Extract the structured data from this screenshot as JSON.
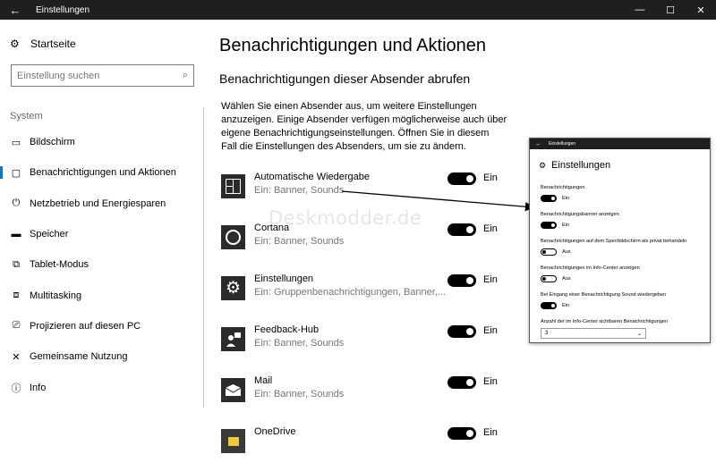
{
  "window": {
    "title": "Einstellungen",
    "back_glyph": "←",
    "min_glyph": "—",
    "max_glyph": "☐",
    "close_glyph": "✕"
  },
  "sidebar": {
    "home_label": "Startseite",
    "search_placeholder": "Einstellung suchen",
    "section_label": "System",
    "items": [
      {
        "label": "Bildschirm",
        "icon": "monitor-icon",
        "glyph": "▭"
      },
      {
        "label": "Benachrichtigungen und Aktionen",
        "icon": "notification-icon",
        "glyph": "▢"
      },
      {
        "label": "Netzbetrieb und Energiesparen",
        "icon": "power-icon",
        "glyph": "⏻"
      },
      {
        "label": "Speicher",
        "icon": "storage-icon",
        "glyph": "▬"
      },
      {
        "label": "Tablet-Modus",
        "icon": "tablet-icon",
        "glyph": "⧉"
      },
      {
        "label": "Multitasking",
        "icon": "multitasking-icon",
        "glyph": "⧈"
      },
      {
        "label": "Projizieren auf diesen PC",
        "icon": "project-icon",
        "glyph": "⎚"
      },
      {
        "label": "Gemeinsame Nutzung",
        "icon": "shared-icon",
        "glyph": "✕"
      },
      {
        "label": "Info",
        "icon": "info-icon",
        "glyph": "ⓘ"
      }
    ]
  },
  "main": {
    "title": "Benachrichtigungen und Aktionen",
    "subtitle": "Benachrichtigungen dieser Absender abrufen",
    "description": "Wählen Sie einen Absender aus, um weitere Einstellungen anzuzeigen. Einige Absender verfügen möglicherweise auch über eigene Benachrichtigungseinstellungen. Öffnen Sie in diesem Fall die Einstellungen des Absenders, um sie zu ändern.",
    "toggle_on_label": "Ein",
    "senders": [
      {
        "name": "Automatische Wiedergabe",
        "sub": "Ein: Banner, Sounds",
        "icon": "autoplay-icon"
      },
      {
        "name": "Cortana",
        "sub": "Ein: Banner, Sounds",
        "icon": "cortana-icon"
      },
      {
        "name": "Einstellungen",
        "sub": "Ein: Gruppenbenachrichtigungen, Banner,...",
        "icon": "settings-gear-icon"
      },
      {
        "name": "Feedback-Hub",
        "sub": "Ein: Banner, Sounds",
        "icon": "feedback-hub-icon"
      },
      {
        "name": "Mail",
        "sub": "Ein: Banner, Sounds",
        "icon": "mail-icon"
      },
      {
        "name": "OneDrive",
        "sub": "",
        "icon": "onedrive-icon"
      }
    ]
  },
  "watermark": "Deskmodder.de",
  "popup": {
    "bar_title": "Einstellungen",
    "heading": "Einstellungen",
    "rows": [
      {
        "label": "Benachrichtigungen",
        "state": "Ein",
        "on": true
      },
      {
        "label": "Benachrichtigungsbanner anzeigen",
        "state": "Ein",
        "on": true
      },
      {
        "label": "Benachrichtigungen auf dem Sperrbildschirm als privat behandeln",
        "state": "Aus",
        "on": false
      },
      {
        "label": "Benachrichtigungen im Info-Center anzeigen",
        "state": "Aus",
        "on": false
      },
      {
        "label": "Bei Eingang einer Benachrichtigung Sound wiedergeben",
        "state": "Ein",
        "on": true
      }
    ],
    "count_label": "Anzahl der im Info-Center sichtbaren Benachrichtigungen",
    "count_value": "3"
  }
}
